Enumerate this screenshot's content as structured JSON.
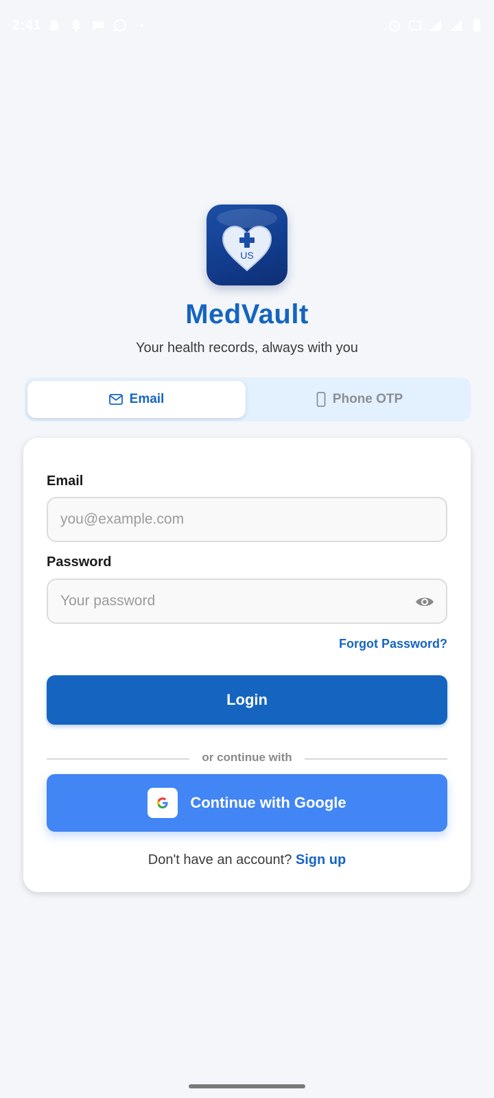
{
  "status_bar": {
    "time": "2:41"
  },
  "app": {
    "logo_text": "US",
    "title": "MedVault",
    "subtitle": "Your health records, always with you"
  },
  "tabs": {
    "email_label": "Email",
    "phone_label": "Phone OTP",
    "active": "email"
  },
  "form": {
    "email_label": "Email",
    "email_placeholder": "you@example.com",
    "email_value": "",
    "password_label": "Password",
    "password_placeholder": "Your password",
    "password_value": "",
    "forgot_password": "Forgot Password?",
    "login_button": "Login",
    "divider_text": "or continue with",
    "google_button": "Continue with Google",
    "no_account_text": "Don't have an account?",
    "signup_link": "Sign up"
  },
  "colors": {
    "primary": "#1565c0",
    "google_blue": "#4285f4",
    "tab_background": "#e3f0fd",
    "page_background": "#f4f6fa"
  }
}
